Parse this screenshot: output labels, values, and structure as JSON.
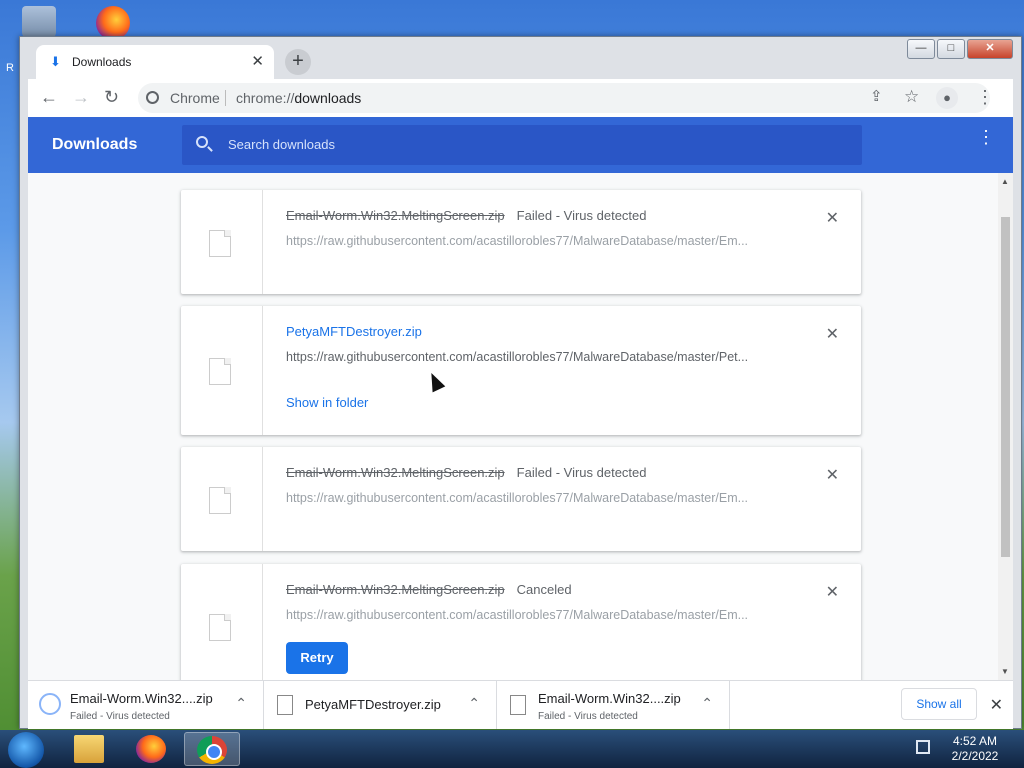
{
  "window": {
    "tab_title": "Downloads",
    "new_tab": "+",
    "controls": {
      "minimize": "—",
      "maximize": "□",
      "close": "✕"
    }
  },
  "toolbar": {
    "site_label": "Chrome",
    "url_scheme": "chrome://",
    "url_path": "downloads"
  },
  "downloads_page": {
    "title": "Downloads",
    "search_placeholder": "Search downloads",
    "items": [
      {
        "filename": "Email-Worm.Win32.MeltingScreen.zip",
        "status": "Failed - Virus detected",
        "url": "https://raw.githubusercontent.com/acastillorobles77/MalwareDatabase/master/Em...",
        "state": "failed"
      },
      {
        "filename": "PetyaMFTDestroyer.zip",
        "status": "",
        "url": "https://raw.githubusercontent.com/acastillorobles77/MalwareDatabase/master/Pet...",
        "action": "Show in folder",
        "state": "complete"
      },
      {
        "filename": "Email-Worm.Win32.MeltingScreen.zip",
        "status": "Failed - Virus detected",
        "url": "https://raw.githubusercontent.com/acastillorobles77/MalwareDatabase/master/Em...",
        "state": "failed"
      },
      {
        "filename": "Email-Worm.Win32.MeltingScreen.zip",
        "status": "Canceled",
        "url": "https://raw.githubusercontent.com/acastillorobles77/MalwareDatabase/master/Em...",
        "action": "Retry",
        "state": "canceled"
      }
    ]
  },
  "shelf": {
    "items": [
      {
        "name": "Email-Worm.Win32....zip",
        "status": "Failed - Virus detected"
      },
      {
        "name": "PetyaMFTDestroyer.zip",
        "status": ""
      },
      {
        "name": "Email-Worm.Win32....zip",
        "status": "Failed - Virus detected"
      }
    ],
    "show_all": "Show all"
  },
  "taskbar": {
    "time": "4:52 AM",
    "date": "2/2/2022"
  },
  "desktop": {
    "label_fragment": "R"
  },
  "colors": {
    "header_blue": "#3367d6",
    "link_blue": "#1a73e8"
  }
}
